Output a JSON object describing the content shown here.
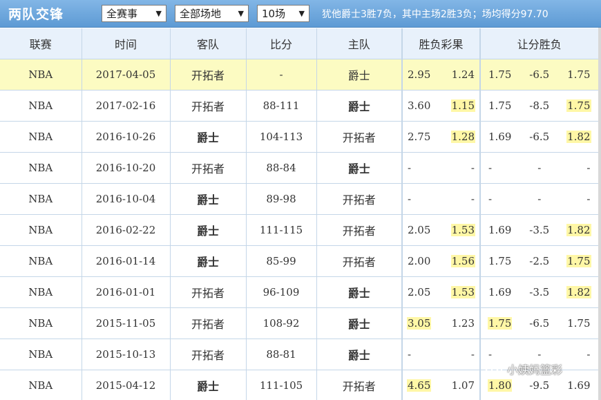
{
  "header": {
    "title": "两队交锋",
    "filters": [
      {
        "selected": "全赛事"
      },
      {
        "selected": "全部场地"
      },
      {
        "selected": "10场"
      }
    ],
    "summary": "犹他爵士3胜7负，其中主场2胜3负；场均得分97.70"
  },
  "columns": {
    "league": "联赛",
    "time": "时间",
    "away": "客队",
    "score": "比分",
    "home": "主队",
    "moneyline": "胜负彩果",
    "handicap": "让分胜负"
  },
  "rows": [
    {
      "league": "NBA",
      "date": "2017-04-05",
      "away": "开拓者",
      "score": "-",
      "home": "爵士",
      "ml": [
        "2.95",
        "1.24"
      ],
      "hc": [
        "1.75",
        "-6.5",
        "1.75"
      ]
    },
    {
      "league": "NBA",
      "date": "2017-02-16",
      "away": "开拓者",
      "score": "88-111",
      "home": "爵士",
      "ml": [
        "3.60",
        "1.15"
      ],
      "hc": [
        "1.75",
        "-8.5",
        "1.75"
      ]
    },
    {
      "league": "NBA",
      "date": "2016-10-26",
      "away": "爵士",
      "score": "104-113",
      "home": "开拓者",
      "ml": [
        "2.75",
        "1.28"
      ],
      "hc": [
        "1.69",
        "-6.5",
        "1.82"
      ]
    },
    {
      "league": "NBA",
      "date": "2016-10-20",
      "away": "开拓者",
      "score": "88-84",
      "home": "爵士",
      "ml": [
        "-",
        "-"
      ],
      "hc": [
        "-",
        "-",
        "-"
      ]
    },
    {
      "league": "NBA",
      "date": "2016-10-04",
      "away": "爵士",
      "score": "89-98",
      "home": "开拓者",
      "ml": [
        "-",
        "-"
      ],
      "hc": [
        "-",
        "-",
        "-"
      ]
    },
    {
      "league": "NBA",
      "date": "2016-02-22",
      "away": "爵士",
      "score": "111-115",
      "home": "开拓者",
      "ml": [
        "2.05",
        "1.53"
      ],
      "hc": [
        "1.69",
        "-3.5",
        "1.82"
      ]
    },
    {
      "league": "NBA",
      "date": "2016-01-14",
      "away": "爵士",
      "score": "85-99",
      "home": "开拓者",
      "ml": [
        "2.00",
        "1.56"
      ],
      "hc": [
        "1.75",
        "-2.5",
        "1.75"
      ]
    },
    {
      "league": "NBA",
      "date": "2016-01-01",
      "away": "开拓者",
      "score": "96-109",
      "home": "爵士",
      "ml": [
        "2.05",
        "1.53"
      ],
      "hc": [
        "1.69",
        "-3.5",
        "1.82"
      ]
    },
    {
      "league": "NBA",
      "date": "2015-11-05",
      "away": "开拓者",
      "score": "108-92",
      "home": "爵士",
      "ml": [
        "3.05",
        "1.23"
      ],
      "hc": [
        "1.75",
        "-6.5",
        "1.75"
      ]
    },
    {
      "league": "NBA",
      "date": "2015-10-13",
      "away": "开拓者",
      "score": "88-81",
      "home": "爵士",
      "ml": [
        "-",
        "-"
      ],
      "hc": [
        "-",
        "-",
        "-"
      ]
    },
    {
      "league": "NBA",
      "date": "2015-04-12",
      "away": "爵士",
      "score": "111-105",
      "home": "开拓者",
      "ml": [
        "4.65",
        "1.07"
      ],
      "hc": [
        "1.80",
        "-9.5",
        "1.69"
      ]
    }
  ],
  "watermark": "小姨妈篮彩",
  "colors": {
    "header_bar": "#6fa8dc",
    "column_header_bg": "#e8f1fb",
    "upcoming_row": "#fcfbc2",
    "odds_highlight": "#fff7a6",
    "winner_red": "#d41c1c",
    "team_blue": "#2166c9"
  }
}
